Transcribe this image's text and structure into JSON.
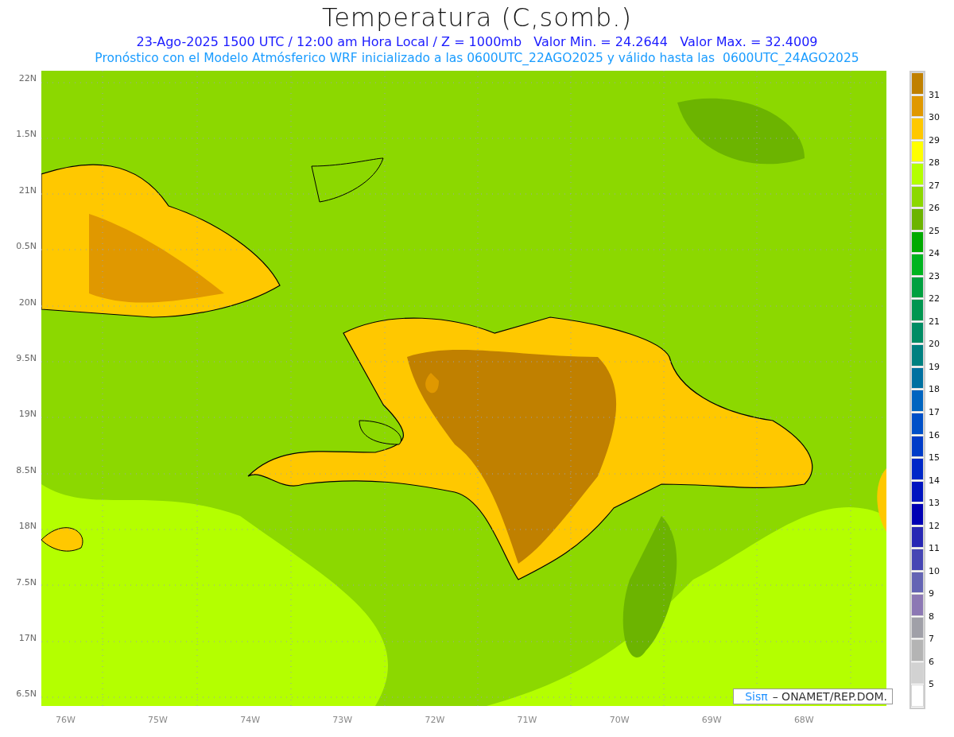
{
  "title": "Temperatura (C,somb.)",
  "subtitle_lines": [
    "23-Ago-2025 1500 UTC / 12:00 am Hora Local / Z = 1000mb   Valor Min. = 24.2644   Valor Max. = 32.4009",
    "Pronóstico con el Modelo Atmósferico WRF inicializado a las 0600UTC_22AGO2025 y válido hasta las  0600UTC_24AGO2025"
  ],
  "map": {
    "latitude_labels": [
      "22N",
      "1.5N",
      "21N",
      "0.5N",
      "20N",
      "9.5N",
      "19N",
      "8.5N",
      "18N",
      "7.5N",
      "17N",
      "6.5N"
    ],
    "longitude_labels": [
      "76W",
      "75W",
      "74W",
      "73W",
      "72W",
      "71W",
      "70W",
      "69W",
      "68W"
    ],
    "credit": {
      "logo": "Sisπ",
      "text": "– ONAMET/REP.DOM."
    }
  },
  "colorbar": [
    {
      "color": "#c08000",
      "label": "31"
    },
    {
      "color": "#e09800",
      "label": "30"
    },
    {
      "color": "#ffc800",
      "label": "29"
    },
    {
      "color": "#ffff00",
      "label": "28"
    },
    {
      "color": "#b4ff00",
      "label": "27"
    },
    {
      "color": "#8cd800",
      "label": "26"
    },
    {
      "color": "#6cb400",
      "label": "25"
    },
    {
      "color": "#00aa00",
      "label": "24"
    },
    {
      "color": "#00b420",
      "label": "23"
    },
    {
      "color": "#00a040",
      "label": "22"
    },
    {
      "color": "#009650",
      "label": "21"
    },
    {
      "color": "#008c64",
      "label": "20"
    },
    {
      "color": "#008080",
      "label": "19"
    },
    {
      "color": "#0070a0",
      "label": "18"
    },
    {
      "color": "#0064c0",
      "label": "17"
    },
    {
      "color": "#0050c8",
      "label": "16"
    },
    {
      "color": "#003cc8",
      "label": "15"
    },
    {
      "color": "#0028c8",
      "label": "14"
    },
    {
      "color": "#0014c0",
      "label": "13"
    },
    {
      "color": "#0000b4",
      "label": "12"
    },
    {
      "color": "#2828b4",
      "label": "11"
    },
    {
      "color": "#4646b4",
      "label": "10"
    },
    {
      "color": "#6464b4",
      "label": "9"
    },
    {
      "color": "#8c78b4",
      "label": "8"
    },
    {
      "color": "#a0a0a8",
      "label": "7"
    },
    {
      "color": "#b4b4b4",
      "label": "6"
    },
    {
      "color": "#d2d2d2",
      "label": "5"
    },
    {
      "color": "#ffffff"
    }
  ]
}
